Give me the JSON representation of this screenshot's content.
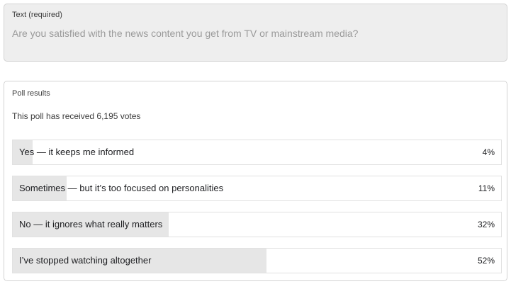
{
  "question": {
    "label": "Text (required)",
    "value": "Are you satisfied with the news content you get from TV or mainstream media?"
  },
  "poll": {
    "title": "Poll results",
    "summary": "This poll has received 6,195 votes",
    "bar_fill_color": "#e6e6e6",
    "options": [
      {
        "label": "Yes — it keeps me informed",
        "percent_text": "4%",
        "percent": 4
      },
      {
        "label": "Sometimes — but it’s too focused on personalities",
        "percent_text": "11%",
        "percent": 11
      },
      {
        "label": "No — it ignores what really matters",
        "percent_text": "32%",
        "percent": 32
      },
      {
        "label": "I’ve stopped watching altogether",
        "percent_text": "52%",
        "percent": 52
      }
    ]
  }
}
